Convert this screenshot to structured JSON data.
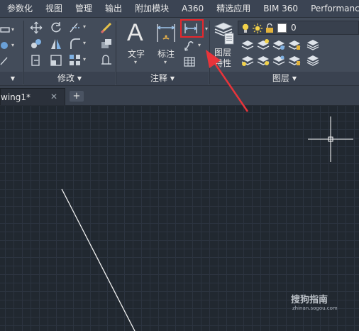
{
  "menu": {
    "items": [
      "参数化",
      "视图",
      "管理",
      "输出",
      "附加模块",
      "A360",
      "精选应用",
      "BIM 360",
      "Performance"
    ]
  },
  "ribbon": {
    "modify_panel": {
      "title": "修改"
    },
    "annotation_panel": {
      "title": "注释",
      "text_tool_label": "文字",
      "dimension_tool_label": "标注"
    },
    "layers_panel": {
      "title": "图层",
      "layer_properties_label_line1": "图层",
      "layer_properties_label_line2": "特性",
      "current_layer": "0"
    }
  },
  "document_tabs": {
    "active_tab_title": "wing1*",
    "new_tab_symbol": "+",
    "close_symbol": "✕"
  },
  "watermark": {
    "main": "搜狗指南",
    "sub": "zhinan.sogou.com"
  },
  "colors": {
    "highlight_box": "#e8272c",
    "arrow": "#e8343a",
    "canvas_background": "#212830",
    "crosshair": "#ffffff"
  }
}
